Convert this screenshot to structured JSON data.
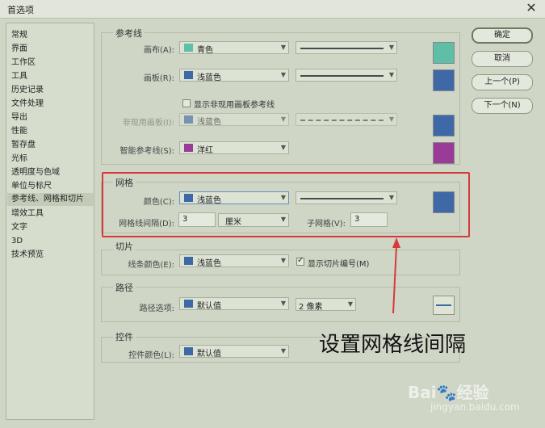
{
  "window": {
    "title": "首选项",
    "close": "✕"
  },
  "sidebar": {
    "items": [
      "常规",
      "界面",
      "工作区",
      "工具",
      "历史记录",
      "文件处理",
      "导出",
      "性能",
      "暂存盘",
      "光标",
      "透明度与色域",
      "单位与标尺",
      "参考线、网格和切片",
      "增效工具",
      "文字",
      "3D",
      "技术预览"
    ],
    "selected_index": 12
  },
  "guides": {
    "title": "参考线",
    "canvas_label": "画布(A):",
    "canvas_value": "青色",
    "canvas_color": "#5fbfa6",
    "artboard_label": "画板(R):",
    "artboard_value": "浅蓝色",
    "artboard_color": "#3f68a6",
    "show_inactive_label": "显示非现用画板参考线",
    "inactive_label": "非现用画板(I):",
    "inactive_value": "浅蓝色",
    "inactive_color": "#3f68a6",
    "smart_label": "智能参考线(S):",
    "smart_value": "洋红",
    "smart_color": "#9a3b97"
  },
  "grid": {
    "title": "网格",
    "color_label": "颜色(C):",
    "color_value": "浅蓝色",
    "color": "#3f68a6",
    "spacing_label": "网格线间隔(D):",
    "spacing_value": "3",
    "spacing_unit": "厘米",
    "subdiv_label": "子网格(V):",
    "subdiv_value": "3"
  },
  "slices": {
    "title": "切片",
    "line_label": "线条颜色(E):",
    "line_value": "浅蓝色",
    "line_color": "#3f68a6",
    "show_numbers_label": "显示切片编号(M)"
  },
  "path": {
    "title": "路径",
    "options_label": "路径选项:",
    "options_value": "默认值",
    "options_color": "#3f68a6",
    "width_value": "2 像素"
  },
  "controls": {
    "title": "控件",
    "color_label": "控件颜色(L):",
    "color_value": "默认值",
    "color": "#3f68a6"
  },
  "buttons": {
    "ok": "确定",
    "cancel": "取消",
    "prev": "上一个(P)",
    "next": "下一个(N)"
  },
  "annotation": {
    "text": "设置网格线间隔",
    "color": "#d9383a"
  },
  "watermark": {
    "text": "Bai🐾经验",
    "url": "jingyan.baidu.com"
  }
}
